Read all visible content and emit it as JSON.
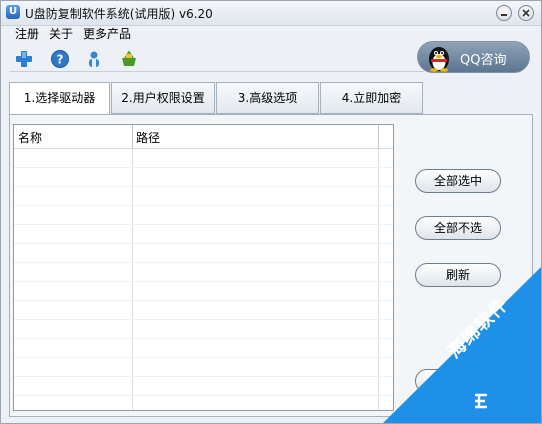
{
  "window": {
    "title": "U盘防复制软件系统(试用版) v6.20",
    "app_icon_glyph": "U"
  },
  "menu": {
    "items": [
      "注册",
      "关于",
      "更多产品"
    ]
  },
  "toolbar": {
    "icons": [
      "add-icon",
      "help-icon",
      "user-icon",
      "basket-icon"
    ]
  },
  "qq": {
    "label": "QQ咨询"
  },
  "tabs": [
    {
      "label": "1.选择驱动器",
      "active": true
    },
    {
      "label": "2.用户权限设置",
      "active": false
    },
    {
      "label": "3.高级选项",
      "active": false
    },
    {
      "label": "4.立即加密",
      "active": false
    }
  ],
  "table": {
    "columns": [
      "名称",
      "路径"
    ],
    "rows": []
  },
  "actions": {
    "select_all": "全部选中",
    "select_none": "全部不选",
    "refresh": "刷新"
  },
  "watermark": {
    "text": "海绵软件"
  },
  "colors": {
    "accent": "#2f86d8",
    "watermark_blue": "#1e90e8",
    "qq_button": "#6f86a0"
  }
}
